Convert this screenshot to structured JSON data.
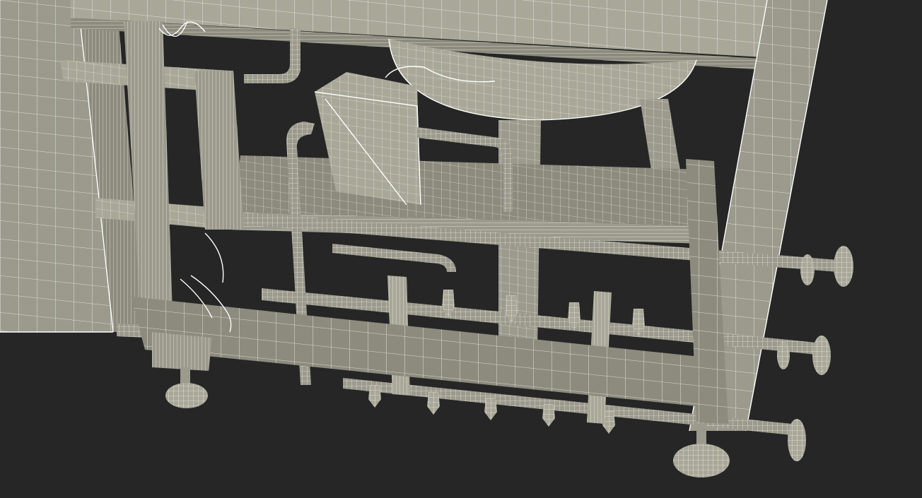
{
  "scene": {
    "subject": "",
    "background_color": "#262626",
    "mesh_fill_color": "#9b9a8c",
    "wire_color": "#f4f4ee",
    "visible_parts": [
      "left-cabinet-panel",
      "top-frame-beam",
      "spherical-tank-bottom",
      "junction-box",
      "vertical-columns",
      "horizontal-pipes",
      "valve-manifolds",
      "pipe-flanges",
      "leveling-feet",
      "cable-bundles"
    ]
  }
}
